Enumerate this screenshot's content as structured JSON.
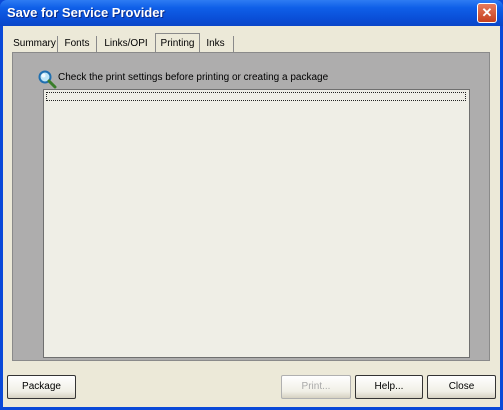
{
  "window": {
    "title": "Save for Service Provider"
  },
  "tabs": [
    {
      "label": "Summary"
    },
    {
      "label": "Fonts"
    },
    {
      "label": "Links/OPI"
    },
    {
      "label": "Printing",
      "active": true
    },
    {
      "label": "Inks"
    }
  ],
  "panel": {
    "message": "Check the print settings before printing or creating a package"
  },
  "buttons": {
    "package": "Package",
    "print": "Print...",
    "help": "Help...",
    "close": "Close"
  },
  "icons": {
    "info": "magnifier-icon",
    "close": "close-icon"
  }
}
